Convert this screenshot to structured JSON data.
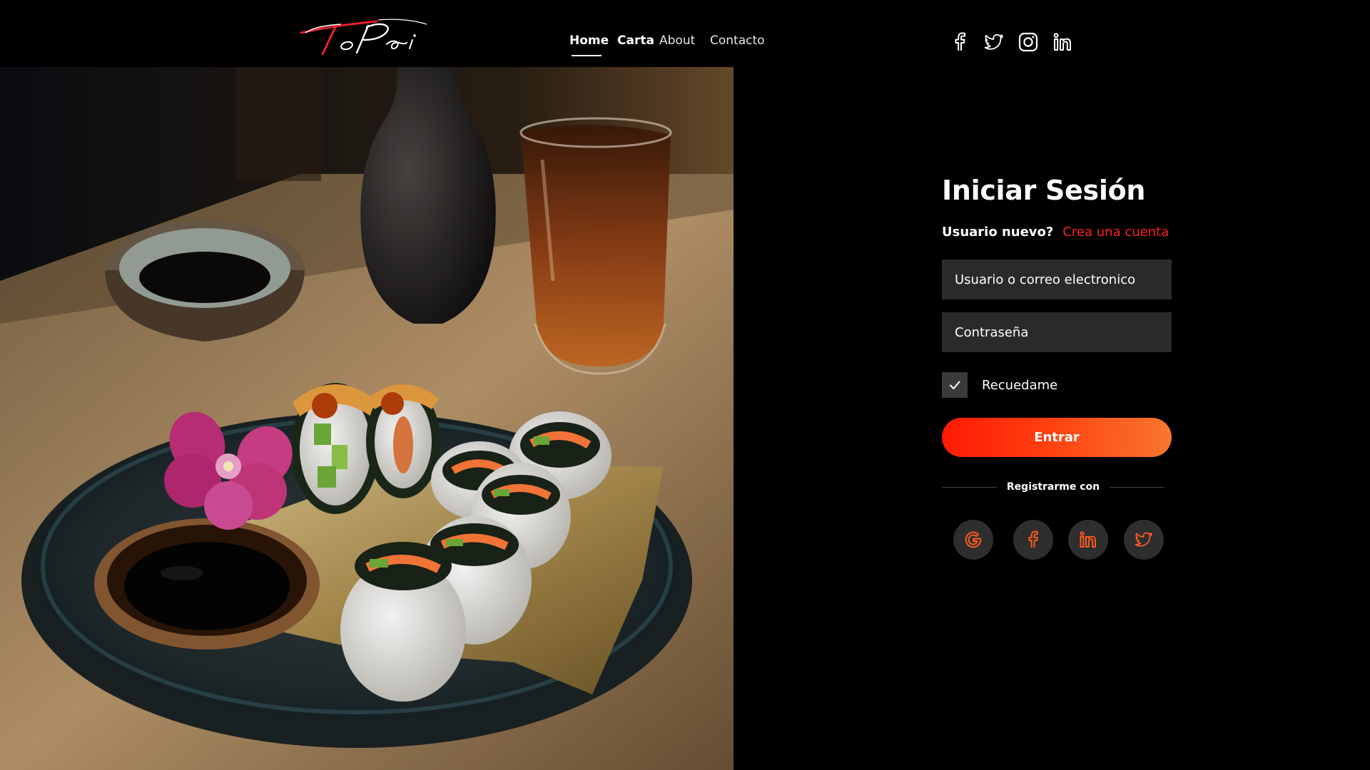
{
  "header": {
    "logo_alt": "ToPai",
    "nav": [
      {
        "label": "Home",
        "active": true
      },
      {
        "label": "Carta"
      },
      {
        "label": "About"
      },
      {
        "label": "Contacto"
      }
    ],
    "socials": [
      {
        "icon": "facebook-icon"
      },
      {
        "icon": "twitter-icon"
      },
      {
        "icon": "instagram-icon"
      },
      {
        "icon": "linkedin-icon"
      }
    ]
  },
  "hero": {
    "alt": "Sushi rolls on a ceramic plate with soy sauce and a glass of tea"
  },
  "login": {
    "title": "Iniciar Sesión",
    "new_user_label": "Usuario nuevo?",
    "create_account_link": "Crea una cuenta",
    "user_placeholder": "Usuario o correo electronico",
    "password_placeholder": "Contraseña",
    "remember_label": "Recuedame",
    "remember_checked": true,
    "submit_label": "Entrar",
    "register_with": "Registrarme con",
    "social_buttons": [
      "google-icon",
      "facebook-icon",
      "linkedin-icon",
      "twitter-icon"
    ]
  },
  "colors": {
    "accent": "#ff1f1f",
    "accent_orange": "#f7772e",
    "field_bg": "#2a2a2a",
    "page_bg": "#000000"
  }
}
